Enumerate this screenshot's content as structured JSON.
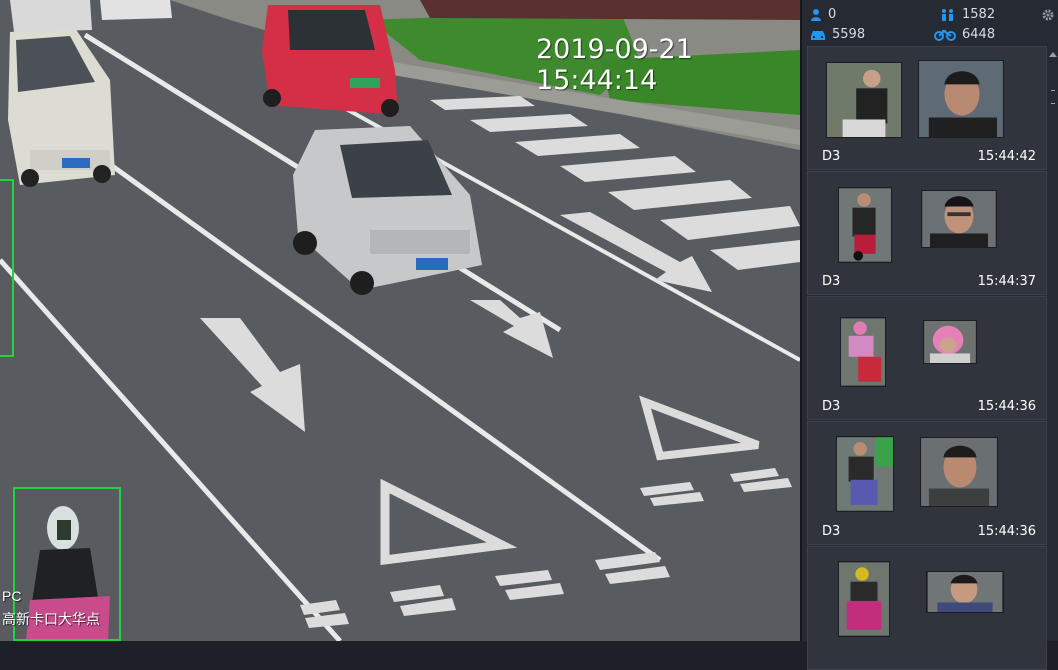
{
  "video": {
    "timestamp": "2019-09-21 15:44:14",
    "camera_label": "PC",
    "camera_location": "高新卡口大华点"
  },
  "stats": {
    "person": "0",
    "non_motor_people": "1582",
    "vehicle": "5598",
    "bicycle": "6448"
  },
  "colors": {
    "accent": "#2196f3",
    "detect": "#21d33c"
  },
  "captures": [
    {
      "channel": "D3",
      "time": "15:44:42"
    },
    {
      "channel": "D3",
      "time": "15:44:37"
    },
    {
      "channel": "D3",
      "time": "15:44:36"
    },
    {
      "channel": "D3",
      "time": "15:44:36"
    },
    {
      "channel": "",
      "time": ""
    }
  ]
}
